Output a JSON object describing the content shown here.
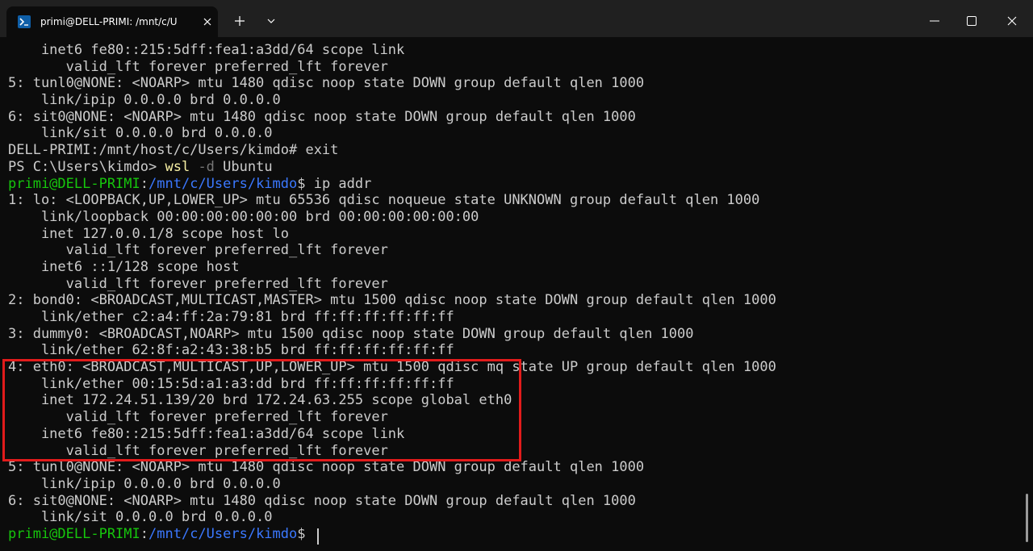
{
  "window": {
    "tab_title": "primi@DELL-PRIMI: /mnt/c/U",
    "tab_icon": "terminal-icon",
    "new_tab_icon": "plus-icon",
    "dropdown_icon": "chevron-down-icon",
    "minimize_icon": "minimize-icon",
    "maximize_icon": "maximize-icon",
    "close_icon": "close-icon"
  },
  "colors": {
    "prompt_user": "#16c60c",
    "prompt_path": "#3b78ff",
    "command": "#f9f1a5",
    "flag": "#767676",
    "highlight_box": "#e21b1b"
  },
  "terminal": {
    "lines": [
      "    inet6 fe80::215:5dff:fea1:a3dd/64 scope link",
      "       valid_lft forever preferred_lft forever",
      "5: tunl0@NONE: <NOARP> mtu 1480 qdisc noop state DOWN group default qlen 1000",
      "    link/ipip 0.0.0.0 brd 0.0.0.0",
      "6: sit0@NONE: <NOARP> mtu 1480 qdisc noop state DOWN group default qlen 1000",
      "    link/sit 0.0.0.0 brd 0.0.0.0",
      "DELL-PRIMI:/mnt/host/c/Users/kimdo# exit"
    ],
    "ps_prompt": "PS C:\\Users\\kimdo> ",
    "ps_command": "wsl",
    "ps_flag": "-d",
    "ps_arg": " Ubuntu",
    "prompt1_user": "primi@DELL-PRIMI",
    "prompt1_colon": ":",
    "prompt1_path": "/mnt/c/Users/kimdo",
    "prompt1_end": "$ ip addr",
    "output": [
      "1: lo: <LOOPBACK,UP,LOWER_UP> mtu 65536 qdisc noqueue state UNKNOWN group default qlen 1000",
      "    link/loopback 00:00:00:00:00:00 brd 00:00:00:00:00:00",
      "    inet 127.0.0.1/8 scope host lo",
      "       valid_lft forever preferred_lft forever",
      "    inet6 ::1/128 scope host",
      "       valid_lft forever preferred_lft forever",
      "2: bond0: <BROADCAST,MULTICAST,MASTER> mtu 1500 qdisc noop state DOWN group default qlen 1000",
      "    link/ether c2:a4:ff:2a:79:81 brd ff:ff:ff:ff:ff:ff",
      "3: dummy0: <BROADCAST,NOARP> mtu 1500 qdisc noop state DOWN group default qlen 1000",
      "    link/ether 62:8f:a2:43:38:b5 brd ff:ff:ff:ff:ff:ff",
      "4: eth0: <BROADCAST,MULTICAST,UP,LOWER_UP> mtu 1500 qdisc mq state UP group default qlen 1000",
      "    link/ether 00:15:5d:a1:a3:dd brd ff:ff:ff:ff:ff:ff",
      "    inet 172.24.51.139/20 brd 172.24.63.255 scope global eth0",
      "       valid_lft forever preferred_lft forever",
      "    inet6 fe80::215:5dff:fea1:a3dd/64 scope link",
      "       valid_lft forever preferred_lft forever",
      "5: tunl0@NONE: <NOARP> mtu 1480 qdisc noop state DOWN group default qlen 1000",
      "    link/ipip 0.0.0.0 brd 0.0.0.0",
      "6: sit0@NONE: <NOARP> mtu 1480 qdisc noop state DOWN group default qlen 1000",
      "    link/sit 0.0.0.0 brd 0.0.0.0"
    ],
    "prompt2_user": "primi@DELL-PRIMI",
    "prompt2_colon": ":",
    "prompt2_path": "/mnt/c/Users/kimdo",
    "prompt2_end": "$ "
  }
}
